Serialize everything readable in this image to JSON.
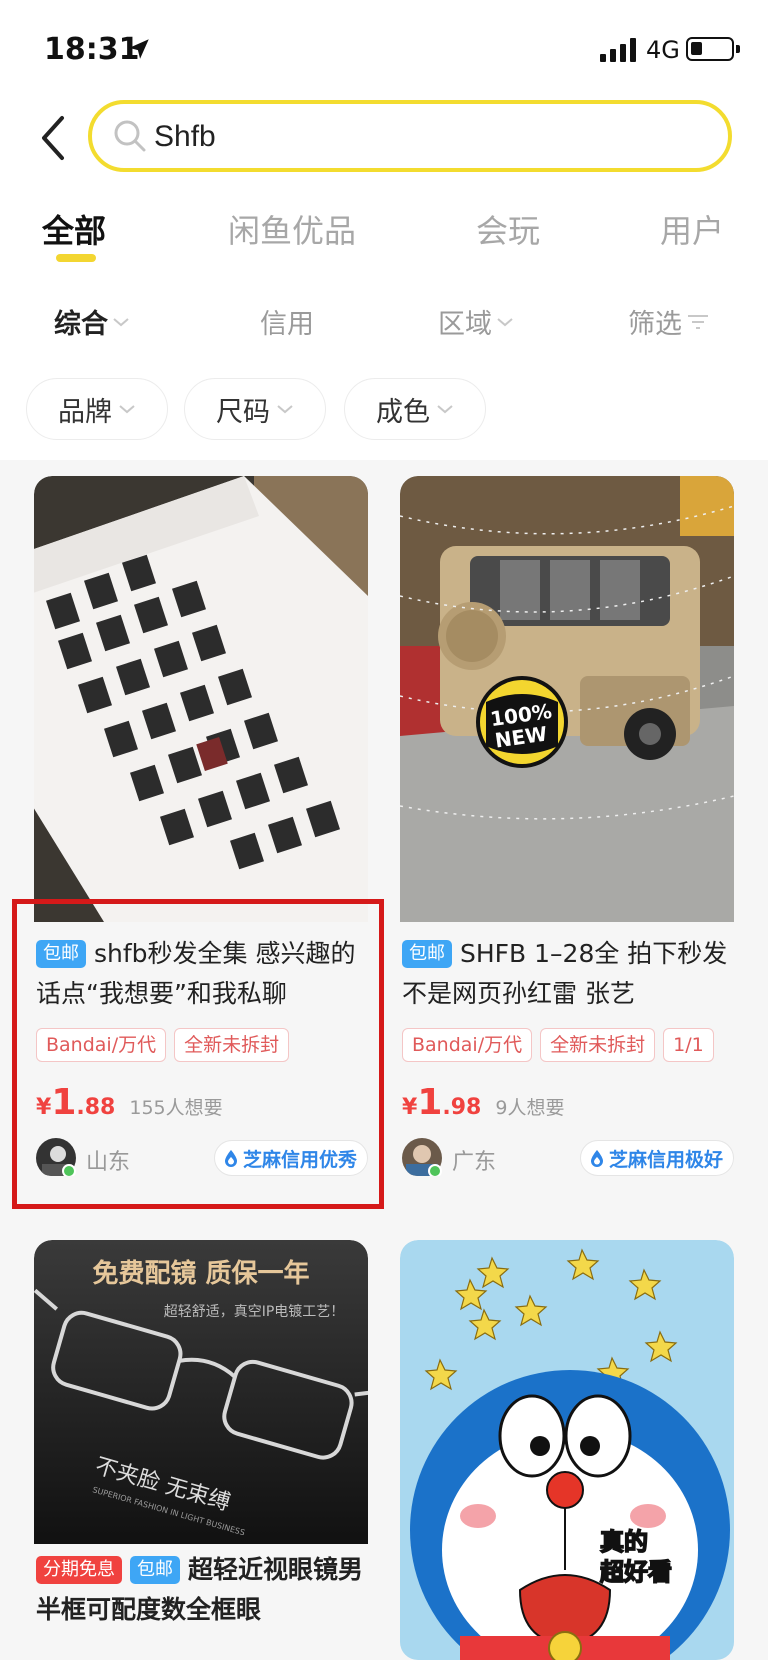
{
  "status_bar": {
    "time": "18:31",
    "network": "4G",
    "battery_level": 0.3
  },
  "search": {
    "value": "Shfb"
  },
  "tabs": [
    {
      "label": "全部",
      "active": true
    },
    {
      "label": "闲鱼优品",
      "active": false
    },
    {
      "label": "会玩",
      "active": false
    },
    {
      "label": "用户",
      "active": false
    }
  ],
  "filters": [
    {
      "label": "综合",
      "active": true
    },
    {
      "label": "信用",
      "active": false
    },
    {
      "label": "区域",
      "active": false
    },
    {
      "label": "筛选",
      "active": false
    }
  ],
  "chips": [
    {
      "label": "品牌"
    },
    {
      "label": "尺码"
    },
    {
      "label": "成色"
    }
  ],
  "listings": [
    {
      "badges": [
        "包邮"
      ],
      "title": "shfb秒发全集 感兴趣的话点“我想要”和我私聊",
      "tags": [
        "Bandai/万代",
        "全新未拆封"
      ],
      "price": {
        "currency": "¥",
        "integer": "1",
        "decimal": ".88"
      },
      "wants": "155人想要",
      "region": "山东",
      "credit": "芝麻信用优秀",
      "highlighted": true
    },
    {
      "badges": [
        "包邮"
      ],
      "title": "SHFB 1–28全 拍下秒发 不是网页孙红雷 张艺",
      "tags": [
        "Bandai/万代",
        "全新未拆封",
        "1/1"
      ],
      "price": {
        "currency": "¥",
        "integer": "1",
        "decimal": ".98"
      },
      "wants": "9人想要",
      "region": "广东",
      "credit": "芝麻信用极好",
      "image_sticker": [
        "100%",
        "NEW"
      ]
    },
    {
      "badges": [
        "分期免息",
        "包邮"
      ],
      "title": "超轻近视眼镜男半框可配度数全框眼",
      "image_text": [
        "免费配镜 质保一年",
        "超轻舒适，真空IP电镀工艺！",
        "不夹脸 无束缚",
        "SUPERIOR FASHION IN LIGHT BUSINESS"
      ]
    },
    {
      "title": "",
      "image_text": [
        "真的",
        "超好看"
      ]
    }
  ],
  "colors": {
    "accent_yellow": "#f3dc2f",
    "price_red": "#f0423f",
    "badge_blue": "#3ea6f5",
    "credit_blue": "#2f86e8",
    "highlight_red": "#d51919"
  }
}
